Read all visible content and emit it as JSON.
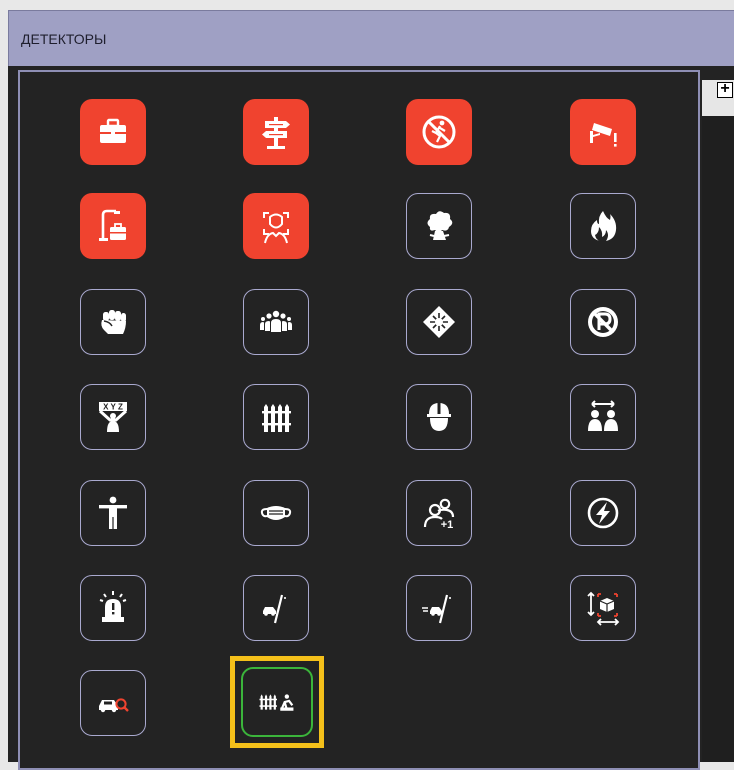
{
  "window": {
    "title": "ДЕТЕКТОРЫ"
  },
  "toolbar": {
    "expand_glyph": "+"
  },
  "colors": {
    "active_tile": "#f0432f",
    "tile_border": "#a9a9cf",
    "selected_outline": "#f4c01a",
    "selected_tile_border": "#3bb53b",
    "panel_bg": "#232323",
    "title_bg": "#9fa0c4"
  },
  "detectors": [
    {
      "icon": "briefcase-icon",
      "active": true
    },
    {
      "icon": "signpost-icon",
      "active": true
    },
    {
      "icon": "no-running-icon",
      "active": true
    },
    {
      "icon": "camera-alert-icon",
      "active": true
    },
    {
      "icon": "abandoned-bag-icon",
      "active": true
    },
    {
      "icon": "face-scan-icon",
      "active": true
    },
    {
      "icon": "smoke-icon",
      "active": false
    },
    {
      "icon": "fire-icon",
      "active": false
    },
    {
      "icon": "fist-icon",
      "active": false
    },
    {
      "icon": "crowd-icon",
      "active": false
    },
    {
      "icon": "area-icon",
      "active": false
    },
    {
      "icon": "no-parking-icon",
      "active": false
    },
    {
      "icon": "xyz-person-icon",
      "active": false
    },
    {
      "icon": "fence-icon",
      "active": false
    },
    {
      "icon": "hard-hat-icon",
      "active": false
    },
    {
      "icon": "people-distance-icon",
      "active": false
    },
    {
      "icon": "person-tpose-icon",
      "active": false
    },
    {
      "icon": "face-mask-icon",
      "active": false
    },
    {
      "icon": "people-plus-one-icon",
      "active": false
    },
    {
      "icon": "power-icon",
      "active": false
    },
    {
      "icon": "alarm-light-icon",
      "active": false
    },
    {
      "icon": "car-line-icon",
      "active": false
    },
    {
      "icon": "car-speed-line-icon",
      "active": false
    },
    {
      "icon": "box-measure-icon",
      "active": false
    },
    {
      "icon": "vehicle-search-icon",
      "active": false
    },
    {
      "icon": "fence-person-icon",
      "active": false,
      "selected": true
    }
  ]
}
